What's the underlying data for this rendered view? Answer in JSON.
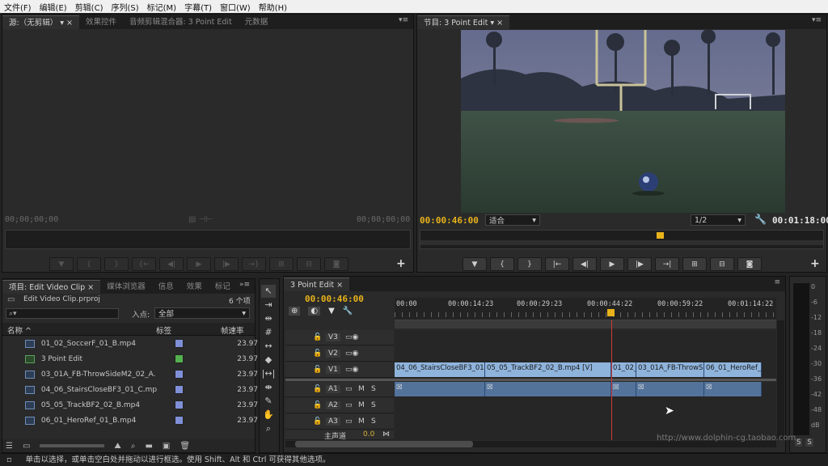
{
  "menu": [
    "文件(F)",
    "编辑(E)",
    "剪辑(C)",
    "序列(S)",
    "标记(M)",
    "字幕(T)",
    "窗口(W)",
    "帮助(H)"
  ],
  "source_panel": {
    "tabs": [
      "源:（无剪辑）",
      "效果控件",
      "音频剪辑混合器: 3 Point Edit",
      "元数据"
    ],
    "timecode_in": "00;00;00;00",
    "timecode_out": "00;00;00;00"
  },
  "program_panel": {
    "tab": "节目: 3 Point Edit",
    "timecode": "00:00:46:00",
    "fit": "适合",
    "resolution": "1/2",
    "duration": "00:01:18:00"
  },
  "project_panel": {
    "tabs": [
      "项目: Edit Video Clip",
      "媒体浏览器",
      "信息",
      "效果",
      "标记"
    ],
    "file": "Edit Video Clip.prproj",
    "count": "6 个项",
    "search_placeholder": "",
    "in_label": "入点:",
    "in_value": "全部",
    "col_name": "名称",
    "col_label": "标签",
    "col_fps": "帧速率",
    "items": [
      {
        "name": "01_02_SoccerF_01_B.mp4",
        "color": "#7f90d8",
        "fps": "23.97"
      },
      {
        "name": "3 Point Edit",
        "color": "#52b04e",
        "fps": "23.97"
      },
      {
        "name": "03_01A_FB-ThrowSideM2_02_A.",
        "color": "#7f90d8",
        "fps": "23.97"
      },
      {
        "name": "04_06_StairsCloseBF3_01_C.mp",
        "color": "#7f90d8",
        "fps": "23.97"
      },
      {
        "name": "05_05_TrackBF2_02_B.mp4",
        "color": "#7f90d8",
        "fps": "23.97"
      },
      {
        "name": "06_01_HeroRef_01_B.mp4",
        "color": "#7f90d8",
        "fps": "23.97"
      }
    ]
  },
  "timeline": {
    "tab": "3 Point Edit",
    "timecode": "00:00:46:00",
    "ruler": [
      "00:00",
      "00:00:14:23",
      "00:00:29:23",
      "00:00:44:22",
      "00:00:59:22",
      "00:01:14:22"
    ],
    "video_tracks": [
      "V3",
      "V2",
      "V1"
    ],
    "audio_tracks": [
      "A1",
      "A2",
      "A3"
    ],
    "mute": "M",
    "solo": "S",
    "master": "主声道",
    "master_val": "0.0",
    "v1_clips": [
      "04_06_StairsCloseBF3_01",
      "05_05_TrackBF2_02_B.mp4 [V]",
      "01_02_",
      "03_01A_FB-ThrowSi",
      "06_01_HeroRef_"
    ]
  },
  "meter": {
    "labels": [
      "0",
      "-6",
      "-12",
      "-18",
      "-24",
      "-30",
      "-36",
      "-42",
      "-48",
      "dB"
    ],
    "bottom": [
      "S",
      "S"
    ]
  },
  "status": "单击以选择，或单击空白处并拖动以进行框选。使用 Shift、Alt 和 Ctrl 可获得其他选项。",
  "watermark": "http://www.dolphin-cg.taobao.com"
}
